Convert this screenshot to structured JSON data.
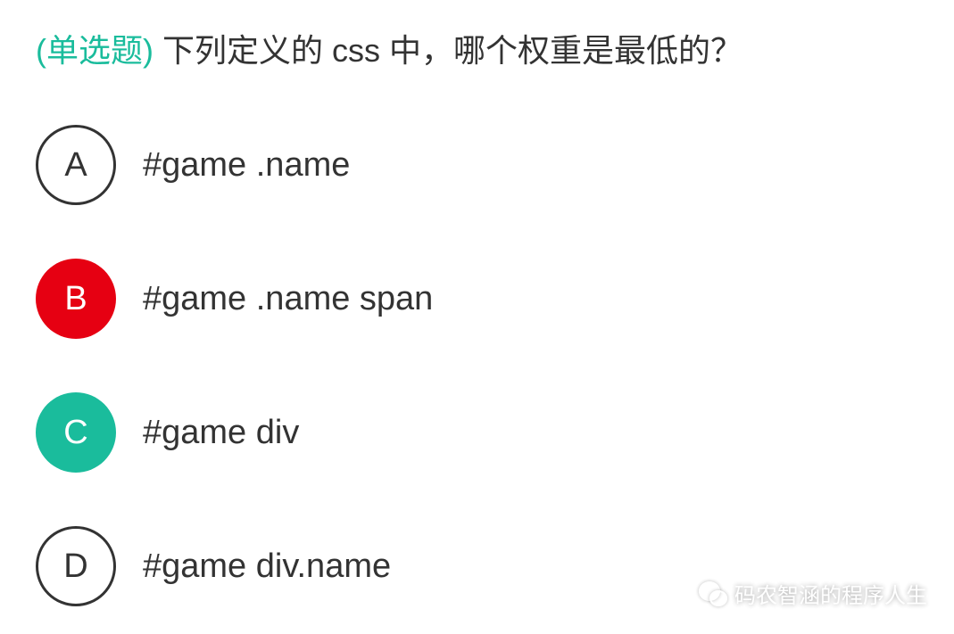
{
  "question": {
    "tag": "(单选题)",
    "text": " 下列定义的 css 中，哪个权重是最低的？"
  },
  "options": [
    {
      "letter": "A",
      "text": "#game .name",
      "state": "default"
    },
    {
      "letter": "B",
      "text": "#game .name span",
      "state": "wrong"
    },
    {
      "letter": "C",
      "text": "#game div",
      "state": "correct"
    },
    {
      "letter": "D",
      "text": "#game div.name",
      "state": "default"
    }
  ],
  "watermark": {
    "text": "码农智涵的程序人生"
  }
}
